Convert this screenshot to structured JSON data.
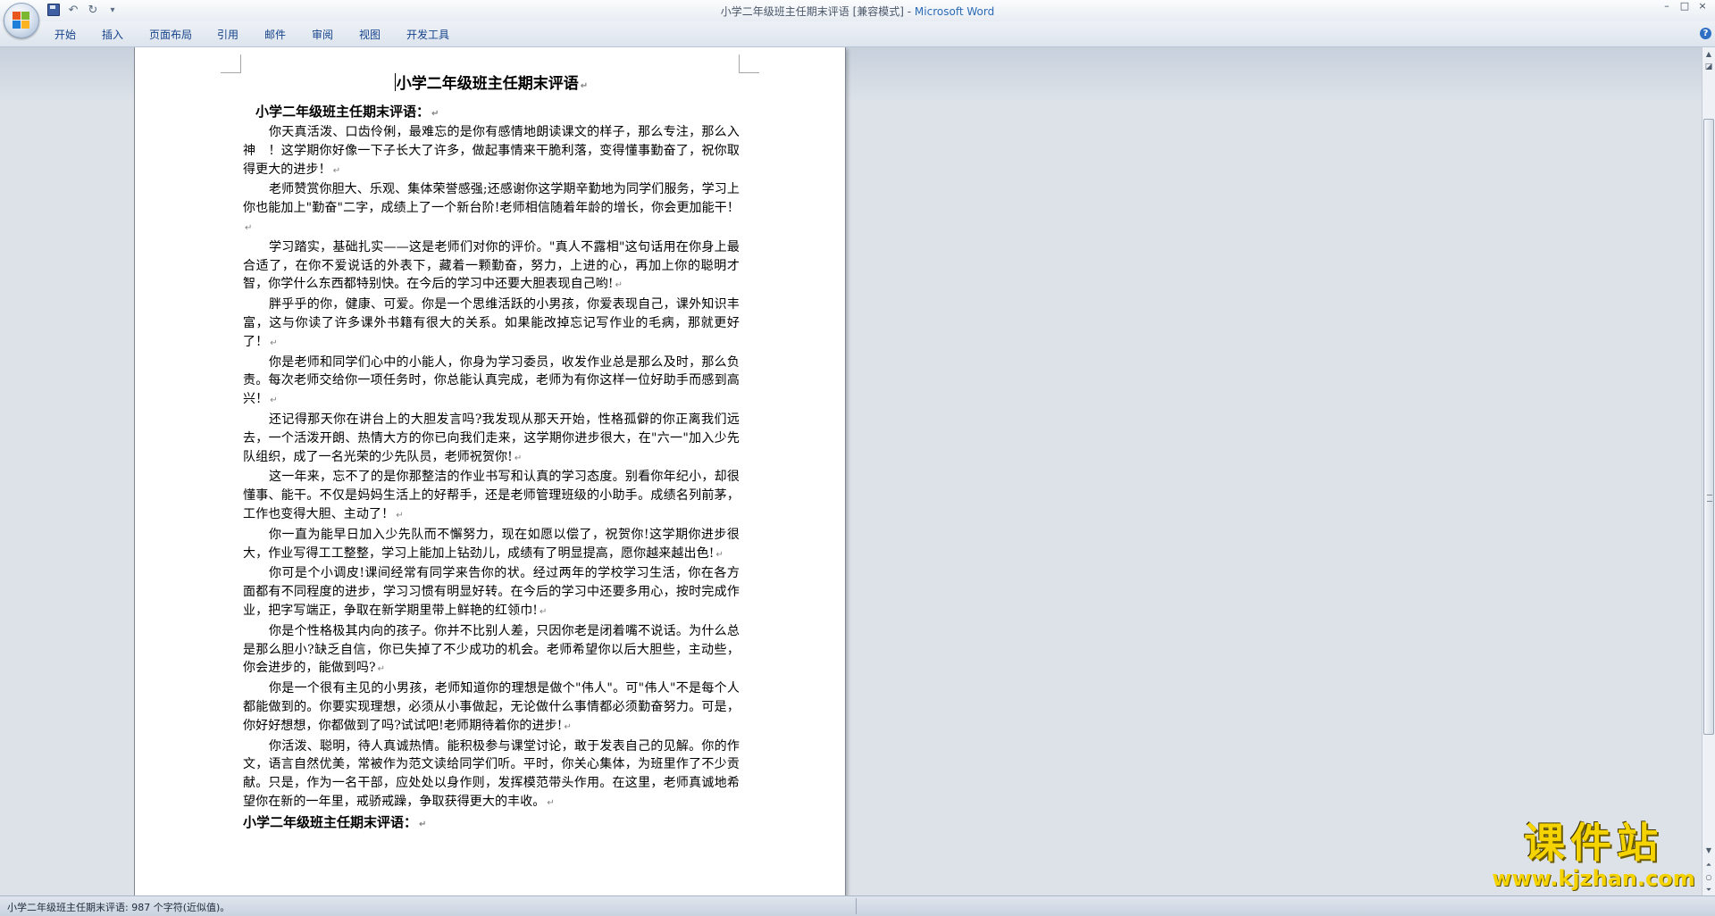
{
  "window": {
    "title": "小学二年级班主任期末评语 [兼容模式] - ",
    "app_name": "Microsoft Word",
    "controls": [
      "–",
      "□",
      "×"
    ]
  },
  "quick_access": {
    "undo_glyph": "↶",
    "redo_glyph": "↻",
    "dropdown_glyph": "▾"
  },
  "ribbon": {
    "tabs": [
      "开始",
      "插入",
      "页面布局",
      "引用",
      "邮件",
      "审阅",
      "视图",
      "开发工具"
    ],
    "help_glyph": "?"
  },
  "document": {
    "title": "小学二年级班主任期末评语",
    "subheading": "小学二年级班主任期末评语：",
    "closing_heading": "小学二年级班主任期末评语：",
    "paragraphs": [
      "你天真活泼、口齿伶俐，最难忘的是你有感情地朗读课文的样子，那么专注，那么入神　！这学期你好像一下子长大了许多，做起事情来干脆利落，变得懂事勤奋了，祝你取得更大的进步！",
      "老师赞赏你胆大、乐观、集体荣誉感强;还感谢你这学期辛勤地为同学们服务，学习上你也能加上\"勤奋\"二字，成绩上了一个新台阶!老师相信随着年龄的增长，你会更加能干！",
      "学习踏实，基础扎实——这是老师们对你的评价。\"真人不露相\"这句话用在你身上最合适了，在你不爱说话的外表下，藏着一颗勤奋，努力，上进的心，再加上你的聪明才智，你学什么东西都特别快。在今后的学习中还要大胆表现自己哟!",
      "胖乎乎的你，健康、可爱。你是一个思维活跃的小男孩，你爱表现自己，课外知识丰富，这与你读了许多课外书籍有很大的关系。如果能改掉忘记写作业的毛病，那就更好了！",
      "你是老师和同学们心中的小能人，你身为学习委员，收发作业总是那么及时，那么负责。每次老师交给你一项任务时，你总能认真完成，老师为有你这样一位好助手而感到高兴！",
      "还记得那天你在讲台上的大胆发言吗?我发现从那天开始，性格孤僻的你正离我们远去，一个活泼开朗、热情大方的你已向我们走来，这学期你进步很大，在\"六一\"加入少先队组织，成了一名光荣的少先队员，老师祝贺你!",
      "这一年来，忘不了的是你那整洁的作业书写和认真的学习态度。别看你年纪小，却很懂事、能干。不仅是妈妈生活上的好帮手，还是老师管理班级的小助手。成绩名列前茅，工作也变得大胆、主动了！",
      "你一直为能早日加入少先队而不懈努力，现在如愿以偿了，祝贺你!这学期你进步很大，作业写得工工整整，学习上能加上钻劲儿，成绩有了明显提高，愿你越来越出色!",
      "你可是个小调皮!课间经常有同学来告你的状。经过两年的学校学习生活，你在各方面都有不同程度的进步，学习习惯有明显好转。在今后的学习中还要多用心，按时完成作业，把字写端正，争取在新学期里带上鲜艳的红领巾!",
      "你是个性格极其内向的孩子。你并不比别人差，只因你老是闭着嘴不说话。为什么总是那么胆小?缺乏自信，你已失掉了不少成功的机会。老师希望你以后大胆些，主动些，你会进步的，能做到吗?",
      "你是一个很有主见的小男孩，老师知道你的理想是做个\"伟人\"。可\"伟人\"不是每个人都能做到的。你要实现理想，必须从小事做起，无论做什么事情都必须勤奋努力。可是，你好好想想，你都做到了吗?试试吧!老师期待着你的进步!",
      "你活泼、聪明，待人真诚热情。能积极参与课堂讨论，敢于发表自己的见解。你的作文，语言自然优美，常被作为范文读给同学们听。平时，你关心集体，为班里作了不少贡献。只是，作为一名干部，应处处以身作则，发挥模范带头作用。在这里，老师真诚地希望你在新的一年里，戒骄戒躁，争取获得更大的丰收。"
    ]
  },
  "statusbar": {
    "text": "小学二年级班主任期末评语: 987 个字符(近似值)。"
  },
  "watermark": {
    "cn": "课件站",
    "url": "www.kjzhan.com"
  },
  "scrollbar": {
    "up": "▲",
    "down": "▼"
  },
  "colors": {
    "accent": "#15428b",
    "app_name": "#2b6bb5",
    "watermark": "#f4d300"
  }
}
